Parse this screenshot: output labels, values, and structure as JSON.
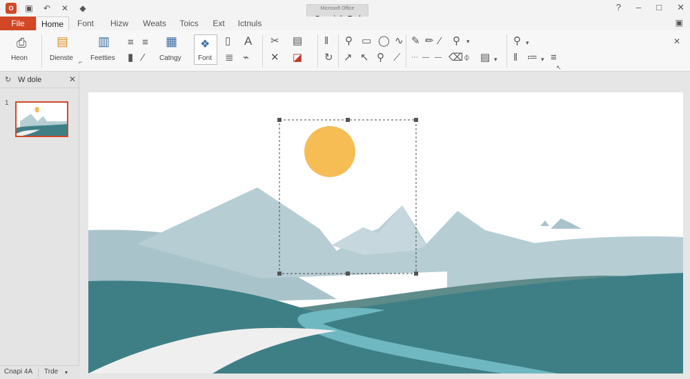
{
  "titlebar": {
    "app_logo": "O",
    "doc_title_small": "Microsoft Office",
    "doc_title": "Cranich Dal",
    "icons": [
      "app-logo-icon",
      "save-icon",
      "undo-icon",
      "redo-icon",
      "pin-icon"
    ]
  },
  "window_controls": {
    "help": "?",
    "minimize": "–",
    "maximize": "□",
    "close": "✕"
  },
  "tabs": [
    "File",
    "Home",
    "Font",
    "Hizw",
    "Weats",
    "Toics",
    "Ext",
    "Ictnuls"
  ],
  "ribbon": {
    "labels": {
      "heon": "Heon",
      "dienste": "Dienste",
      "feetties": "Feetties",
      "catngy": "Catngy",
      "font": "Font"
    }
  },
  "left_pane": {
    "title": "W dole",
    "close": "✕",
    "slide_number": "1"
  },
  "statusbar": {
    "left": "Cnapi 4A",
    "right": "Trde"
  },
  "colors": {
    "accent": "#d24726",
    "sun": "#f6bd55",
    "mountain_light": "#b6cdd4",
    "mountain_mid": "#a9c3cb",
    "hill_dark": "#3e7f86",
    "hill_mid": "#5f8b8a",
    "river": "#6fb8c1",
    "road": "#efefef"
  }
}
